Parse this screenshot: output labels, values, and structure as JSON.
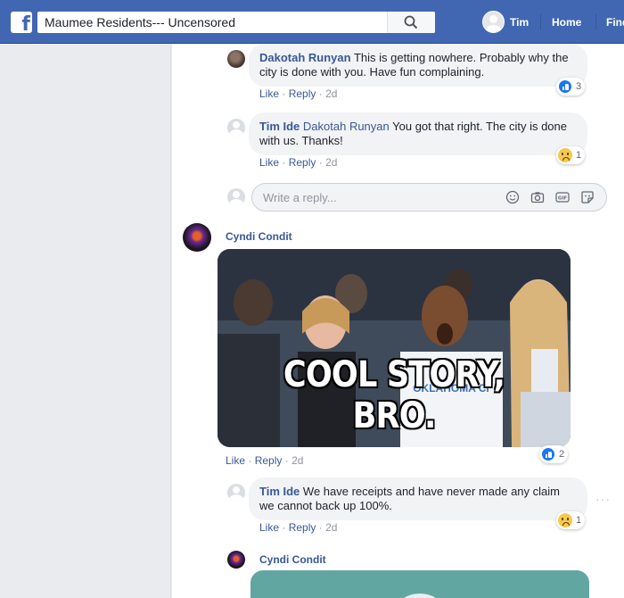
{
  "header": {
    "search_value": "Maumee Residents--- Uncensored",
    "nav": {
      "user": "Tim",
      "home": "Home",
      "find": "Find"
    },
    "brand_color": "#4267b2"
  },
  "comments": [
    {
      "author": "Dakotah Runyan",
      "text": "This is getting nowhere. Probably why the city is done with you. Have fun complaining.",
      "actions": {
        "like": "Like",
        "reply": "Reply",
        "time": "2d"
      },
      "reaction": {
        "icon": "like-icon",
        "count": "3"
      }
    },
    {
      "author": "Tim Ide",
      "mention": "Dakotah Runyan",
      "text": "You got that right. The city is done with us. Thanks!",
      "actions": {
        "like": "Like",
        "reply": "Reply",
        "time": "2d"
      },
      "reaction": {
        "icon": "sad-icon",
        "count": "1"
      }
    },
    {
      "author": "Cyndi Condit",
      "gif_caption": "COOL STORY, BRO.",
      "actions": {
        "like": "Like",
        "reply": "Reply",
        "time": "2d"
      },
      "reaction": {
        "icon": "like-icon",
        "count": "2"
      }
    },
    {
      "author": "Tim Ide",
      "text": "We have receipts and have never made any claim we cannot back up 100%.",
      "actions": {
        "like": "Like",
        "reply": "Reply",
        "time": "2d"
      },
      "reaction": {
        "icon": "sad-icon",
        "count": "1"
      }
    },
    {
      "author": "Cyndi Condit"
    }
  ],
  "reply_box": {
    "placeholder": "Write a reply...",
    "icons": [
      "emoji-icon",
      "camera-icon",
      "gif-icon",
      "sticker-icon"
    ]
  }
}
